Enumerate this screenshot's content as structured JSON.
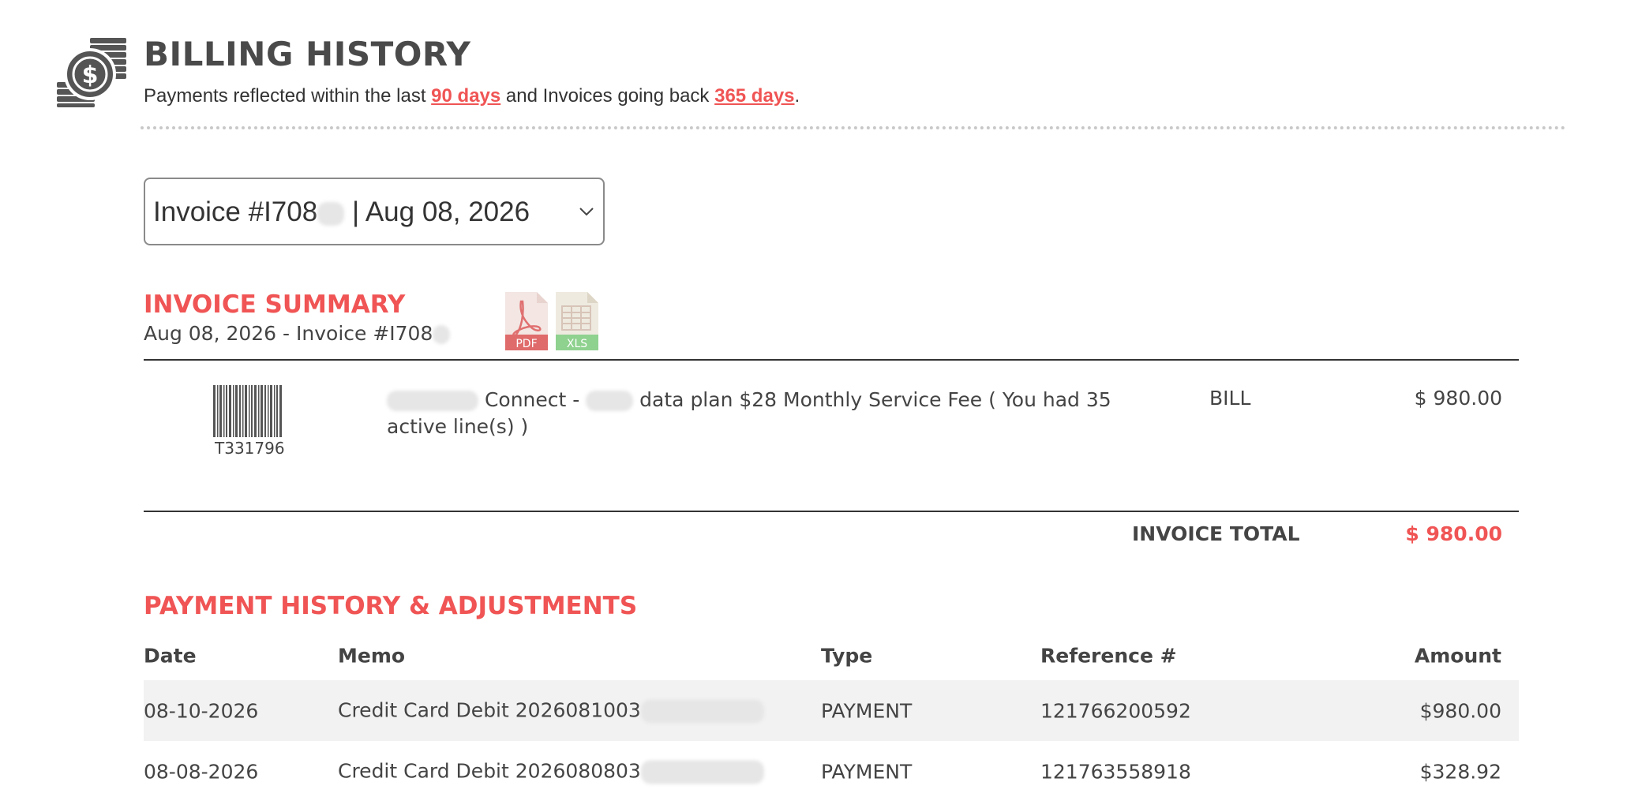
{
  "header": {
    "title": "BILLING HISTORY",
    "subtitle_pre": "Payments reflected within the last ",
    "payments_days_link": "90 days",
    "subtitle_mid": " and Invoices going back ",
    "invoices_days_link": "365 days",
    "subtitle_post": "."
  },
  "invoice_select": {
    "value_prefix": "Invoice #I708",
    "value_suffix": " | Aug 08, 2026"
  },
  "invoice_summary": {
    "title": "INVOICE SUMMARY",
    "subtitle": "Aug 08, 2026 - Invoice #I708",
    "pdf_label": "PDF",
    "xls_label": "XLS"
  },
  "line_item": {
    "barcode_id": "T331796",
    "desc_part1": " Connect - ",
    "desc_part2": " data plan $28 Monthly Service Fee ( You had 35 active line(s) )",
    "type": "BILL",
    "amount": "$ 980.00"
  },
  "invoice_total": {
    "label": "INVOICE TOTAL",
    "value": "$ 980.00"
  },
  "payments": {
    "title": "PAYMENT HISTORY & ADJUSTMENTS",
    "columns": {
      "date": "Date",
      "memo": "Memo",
      "type": "Type",
      "reference": "Reference #",
      "amount": "Amount"
    },
    "rows": [
      {
        "date": "08-10-2026",
        "memo": "Credit Card Debit 2026081003",
        "type": "PAYMENT",
        "reference": "121766200592",
        "amount": "$980.00"
      },
      {
        "date": "08-08-2026",
        "memo": "Credit Card Debit 2026080803",
        "type": "PAYMENT",
        "reference": "121763558918",
        "amount": "$328.92"
      }
    ]
  },
  "colors": {
    "accent": "#f05454",
    "text": "#444444",
    "row_shade": "#f2f2f2",
    "pdf_red": "#e05a5a",
    "xls_green": "#6cc26c"
  }
}
